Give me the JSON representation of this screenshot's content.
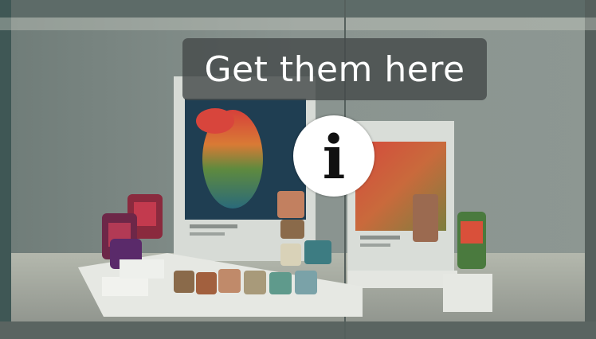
{
  "overlay": {
    "tooltip_text": "Get them here",
    "info_icon": "info-icon"
  }
}
